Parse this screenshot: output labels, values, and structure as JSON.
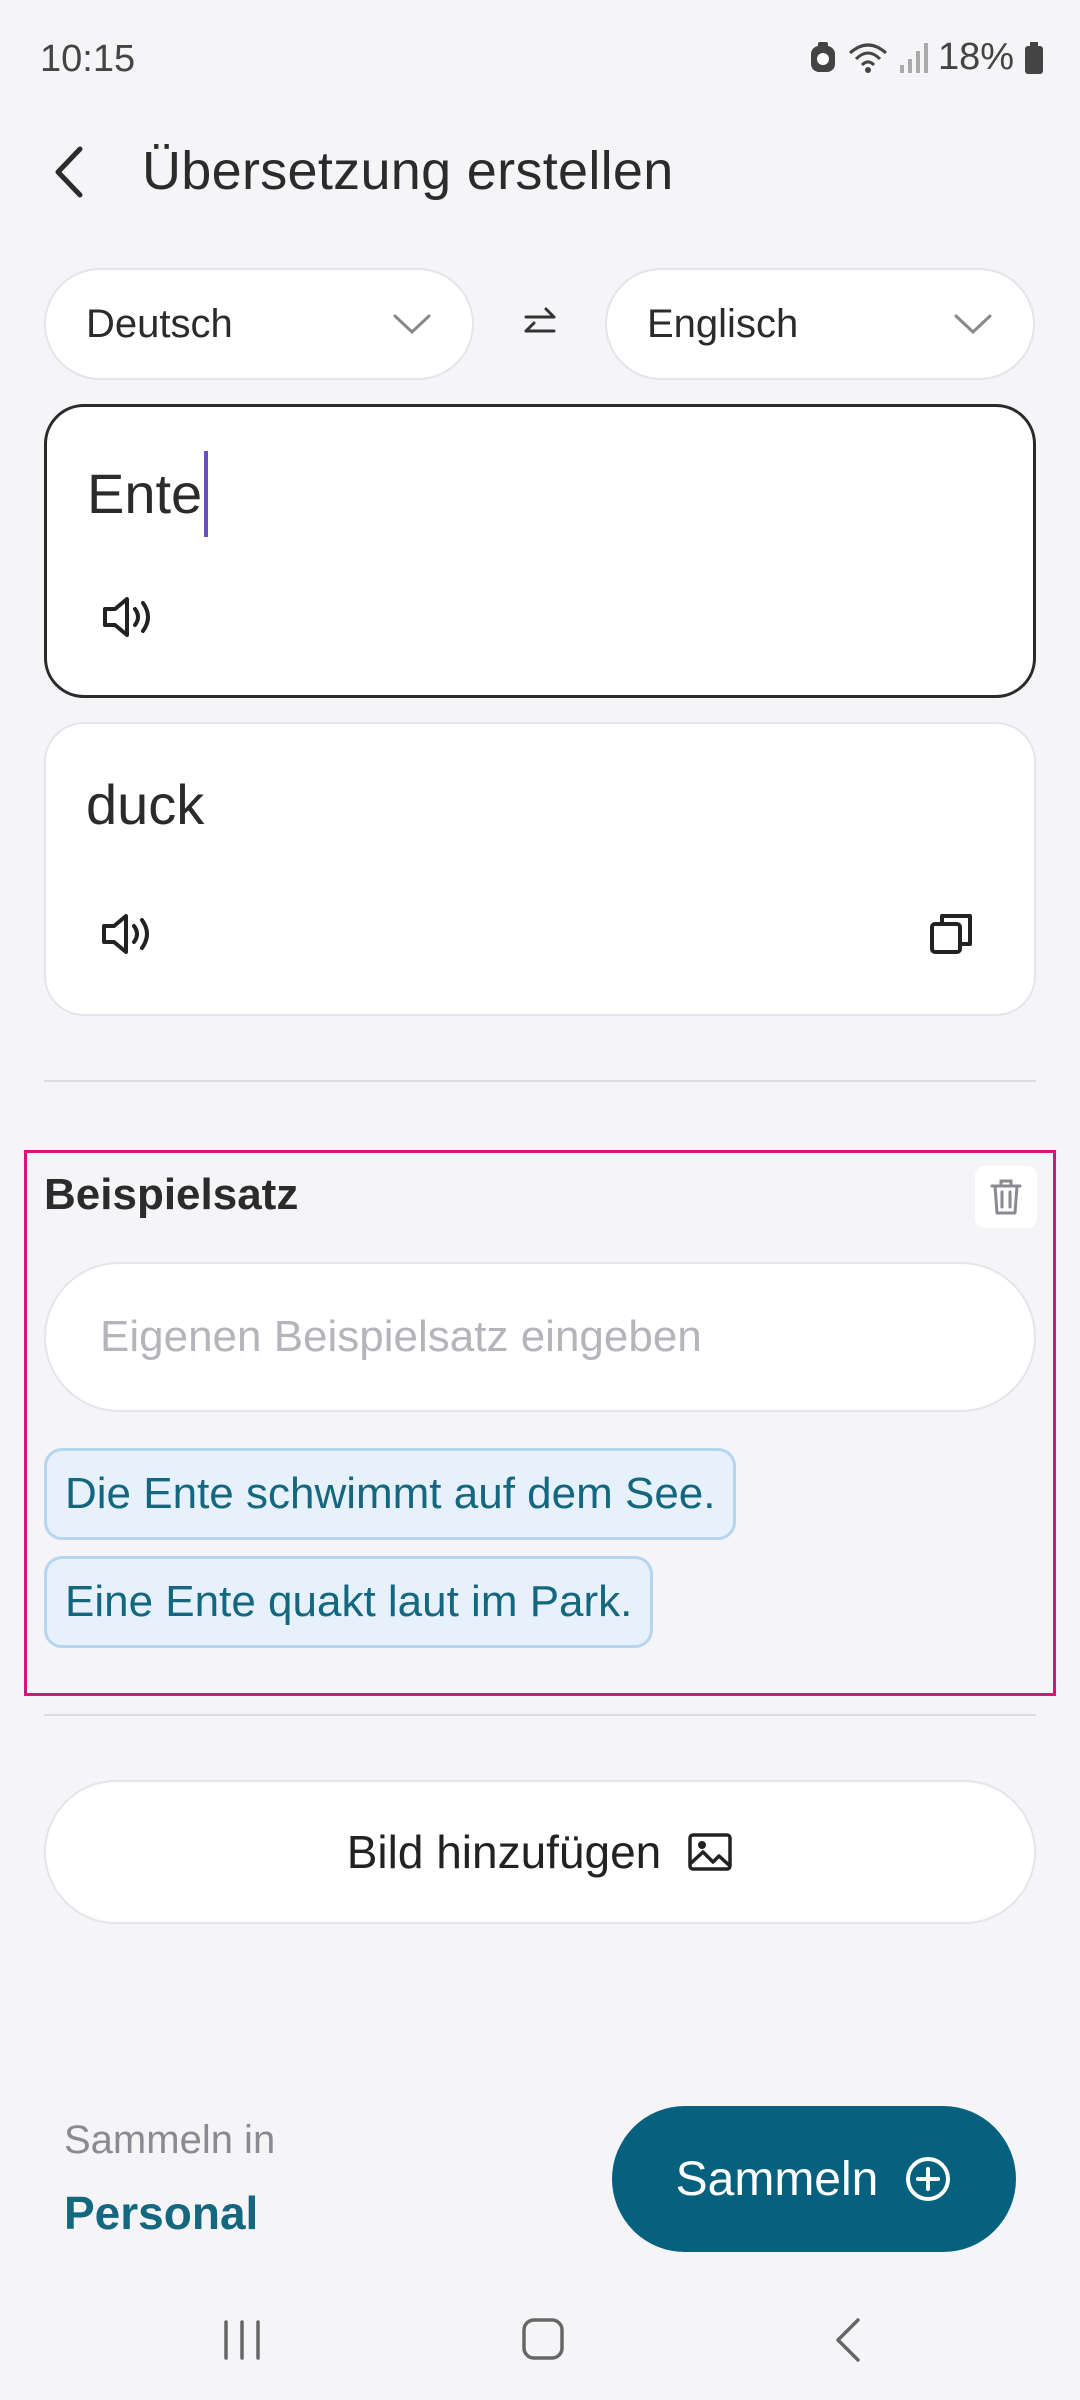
{
  "status_bar": {
    "time": "10:15",
    "battery": "18%"
  },
  "header": {
    "title": "Übersetzung erstellen"
  },
  "languages": {
    "source": "Deutsch",
    "target": "Englisch"
  },
  "source_card": {
    "text": "Ente"
  },
  "target_card": {
    "text": "duck"
  },
  "example_section": {
    "title": "Beispielsatz",
    "input_placeholder": "Eigenen Beispielsatz eingeben",
    "suggestions": [
      "Die Ente schwimmt auf dem See.",
      "Eine Ente quakt laut im Park."
    ]
  },
  "add_image": {
    "label": "Bild hinzufügen"
  },
  "collect": {
    "caption": "Sammeln in",
    "target": "Personal",
    "button_label": "Sammeln"
  },
  "colors": {
    "accent": "#05617d",
    "highlight_border": "#d4187a",
    "chip_text": "#14677e"
  }
}
